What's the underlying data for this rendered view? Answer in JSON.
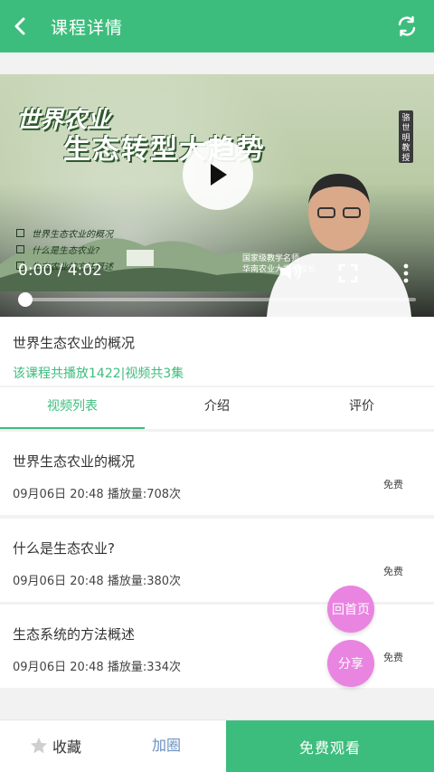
{
  "header": {
    "title": "课程详情",
    "back_icon": "chevron-left-icon",
    "refresh_icon": "refresh-icon"
  },
  "video": {
    "poster_title_1": "世界农业",
    "poster_title_2": "生态转型大趋势",
    "poster_badge": "骆世明教授",
    "poster_list": [
      "世界生态农业的概况",
      "什么是生态农业?",
      "生态农业的方法概述"
    ],
    "poster_caption_1": "国家级教学名师",
    "poster_caption_2": "华南农业大学原校长",
    "time": "0:00 / 4:02",
    "progress": 0.0
  },
  "course": {
    "title": "世界生态农业的概况",
    "stats": "该课程共播放1422|视频共3集"
  },
  "tabs": [
    {
      "label": "视频列表"
    },
    {
      "label": "介绍"
    },
    {
      "label": "评价"
    }
  ],
  "items": [
    {
      "title": "世界生态农业的概况",
      "meta": "09月06日 20:48 播放量:708次",
      "badge": "免费"
    },
    {
      "title": "什么是生态农业?",
      "meta": "09月06日 20:48 播放量:380次",
      "badge": "免费"
    },
    {
      "title": "生态系统的方法概述",
      "meta": "09月06日 20:48 播放量:334次",
      "badge": "免费"
    }
  ],
  "fab": {
    "home": "回首页",
    "share": "分享"
  },
  "bottom": {
    "favorite": "收藏",
    "join": "加圈",
    "watch": "免费观看"
  },
  "colors": {
    "accent": "#3dbd7d",
    "fab": "#e984e0",
    "link": "#6a8fbf"
  }
}
